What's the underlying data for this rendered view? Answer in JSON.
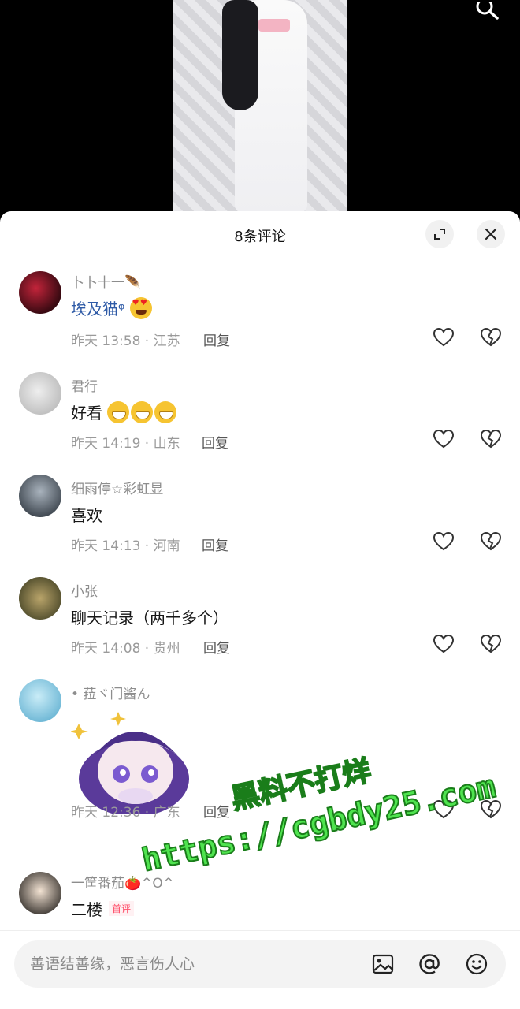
{
  "header": {
    "title": "8条评论"
  },
  "comments": [
    {
      "username": "卜卜十一🪶",
      "text": "埃及猫ᵠ",
      "meta": "昨天 13:58 · 江苏",
      "reply_label": "回复"
    },
    {
      "username": "君行",
      "text": "好看",
      "meta": "昨天 14:19 · 山东",
      "reply_label": "回复"
    },
    {
      "username": "细雨停☆彩虹显",
      "text": "喜欢",
      "meta": "昨天 14:13 · 河南",
      "reply_label": "回复"
    },
    {
      "username": "小张",
      "text": "聊天记录（两千多个）",
      "meta": "昨天 14:08 · 贵州",
      "reply_label": "回复"
    },
    {
      "username": "• 菈ヾ门酱ん",
      "text": "",
      "meta": "昨天 12:36 · 广东",
      "reply_label": "回复"
    },
    {
      "username": "一筐番茄🍅^O^",
      "text": "二楼",
      "badge": "首评"
    }
  ],
  "watermark": {
    "line1": "黑料不打烊",
    "line2": "https://cgbdy25.com"
  },
  "input": {
    "placeholder": "善语结善缘，恶言伤人心"
  },
  "icons": {
    "search": "search-icon",
    "expand": "expand-icon",
    "close": "close-icon",
    "like": "heart-outline-icon",
    "dislike": "broken-heart-icon",
    "image": "image-icon",
    "mention": "at-icon",
    "emoji": "emoji-icon"
  },
  "colors": {
    "link": "#2e5aa6",
    "badge": "#ff4f6a",
    "watermark": "#4fe34f"
  }
}
